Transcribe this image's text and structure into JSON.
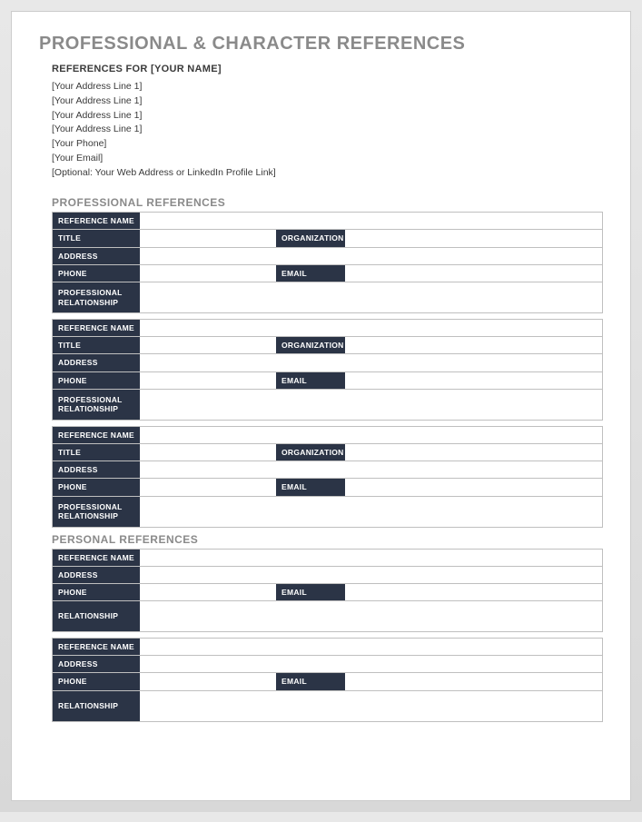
{
  "title": "PROFESSIONAL & CHARACTER REFERENCES",
  "subheading": "REFERENCES FOR [YOUR NAME]",
  "info_lines": [
    "[Your Address Line 1]",
    "[Your Address Line 1]",
    "[Your Address Line 1]",
    "[Your Address Line 1]",
    "[Your Phone]",
    "[Your Email]",
    "[Optional: Your Web Address or LinkedIn Profile Link]"
  ],
  "professional": {
    "heading": "PROFESSIONAL REFERENCES",
    "labels": {
      "reference_name": "REFERENCE NAME",
      "title": "TITLE",
      "organization": "ORGANIZATION",
      "address": "ADDRESS",
      "phone": "PHONE",
      "email": "EMAIL",
      "relationship": "PROFESSIONAL RELATIONSHIP"
    }
  },
  "personal": {
    "heading": "PERSONAL REFERENCES",
    "labels": {
      "reference_name": "REFERENCE NAME",
      "address": "ADDRESS",
      "phone": "PHONE",
      "email": "EMAIL",
      "relationship": "RELATIONSHIP"
    }
  }
}
